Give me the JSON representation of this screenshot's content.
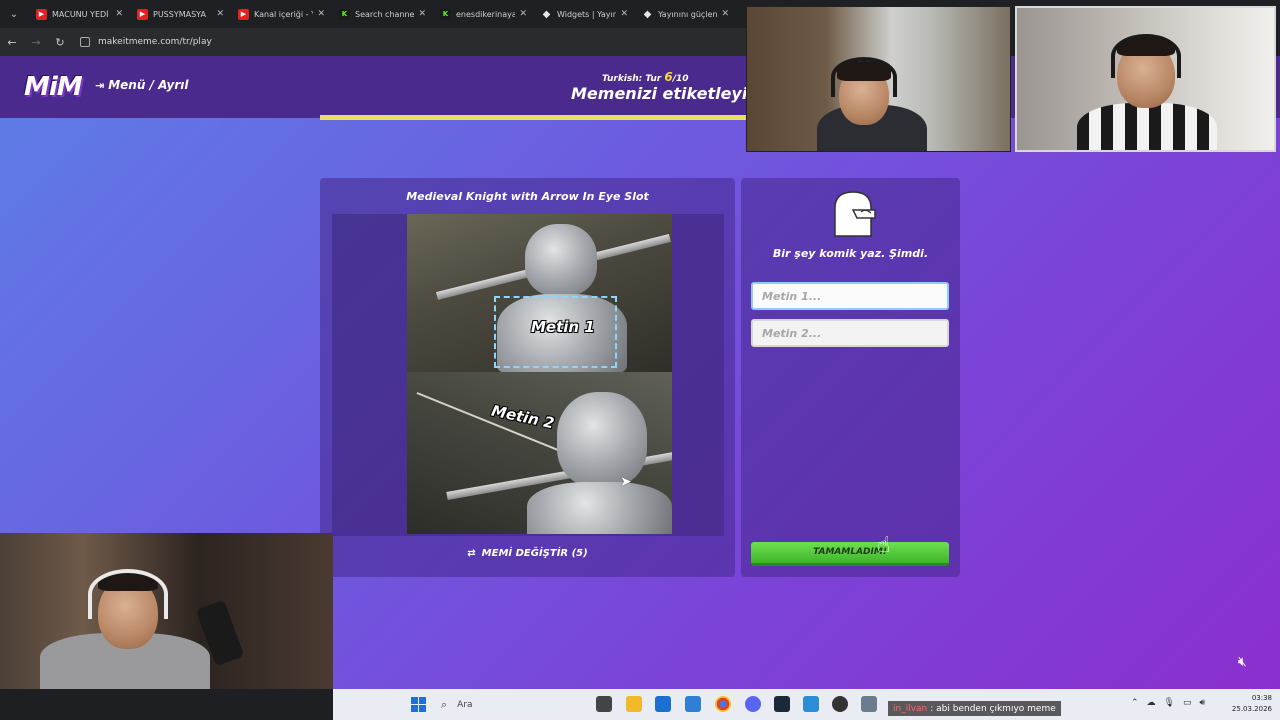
{
  "browser": {
    "tabs": [
      {
        "title": "MACUNU YEDİ",
        "favicon": "youtube-icon"
      },
      {
        "title": "PUSSYMASYA",
        "favicon": "youtube-icon"
      },
      {
        "title": "Kanal içeriği - Y",
        "favicon": "youtube-icon"
      },
      {
        "title": "Search channel",
        "favicon": "kick-icon"
      },
      {
        "title": "enesdikerinaya",
        "favicon": "kick-icon"
      },
      {
        "title": "Widgets | Yayın",
        "favicon": "streamelements-icon"
      },
      {
        "title": "Yayınını güçlen",
        "favicon": "streamelements-icon"
      }
    ],
    "url": "makeitmeme.com/tr/play"
  },
  "game": {
    "logo": "MiM",
    "menu_link": "Menü / Ayrıl",
    "round_label": "Turkish: Tur",
    "round_current": "6",
    "round_total": "/10",
    "round_title": "Memenizi etiketleyin",
    "progress": 1.0,
    "meme_title": "Medieval Knight with Arrow In Eye Slot",
    "meme_label_1": "Metin 1",
    "meme_label_2": "Metin 2",
    "change_meme": "MEMİ DEĞİŞTİR (5)",
    "prompt": "Bir şey komik yaz. Şimdi.",
    "input1_placeholder": "Metin 1...",
    "input2_placeholder": "Metin 2...",
    "done_button": "TAMAMLADIM!",
    "colors": {
      "accent": "#e8e05a",
      "done": "#4fc336",
      "focus": "#8ec9ff"
    }
  },
  "taskbar": {
    "search_placeholder": "Ara",
    "chat_user": "in_ilvan",
    "chat_message": ": abi benden çıkmıyo meme",
    "time": "03:38",
    "date": "25.03.2026"
  }
}
